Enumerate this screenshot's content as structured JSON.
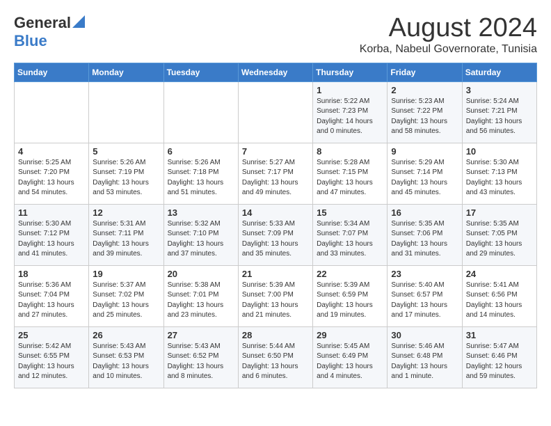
{
  "header": {
    "logo_general": "General",
    "logo_blue": "Blue",
    "month_title": "August 2024",
    "location": "Korba, Nabeul Governorate, Tunisia"
  },
  "days_of_week": [
    "Sunday",
    "Monday",
    "Tuesday",
    "Wednesday",
    "Thursday",
    "Friday",
    "Saturday"
  ],
  "weeks": [
    [
      {
        "day": "",
        "content": ""
      },
      {
        "day": "",
        "content": ""
      },
      {
        "day": "",
        "content": ""
      },
      {
        "day": "",
        "content": ""
      },
      {
        "day": "1",
        "content": "Sunrise: 5:22 AM\nSunset: 7:23 PM\nDaylight: 14 hours\nand 0 minutes."
      },
      {
        "day": "2",
        "content": "Sunrise: 5:23 AM\nSunset: 7:22 PM\nDaylight: 13 hours\nand 58 minutes."
      },
      {
        "day": "3",
        "content": "Sunrise: 5:24 AM\nSunset: 7:21 PM\nDaylight: 13 hours\nand 56 minutes."
      }
    ],
    [
      {
        "day": "4",
        "content": "Sunrise: 5:25 AM\nSunset: 7:20 PM\nDaylight: 13 hours\nand 54 minutes."
      },
      {
        "day": "5",
        "content": "Sunrise: 5:26 AM\nSunset: 7:19 PM\nDaylight: 13 hours\nand 53 minutes."
      },
      {
        "day": "6",
        "content": "Sunrise: 5:26 AM\nSunset: 7:18 PM\nDaylight: 13 hours\nand 51 minutes."
      },
      {
        "day": "7",
        "content": "Sunrise: 5:27 AM\nSunset: 7:17 PM\nDaylight: 13 hours\nand 49 minutes."
      },
      {
        "day": "8",
        "content": "Sunrise: 5:28 AM\nSunset: 7:15 PM\nDaylight: 13 hours\nand 47 minutes."
      },
      {
        "day": "9",
        "content": "Sunrise: 5:29 AM\nSunset: 7:14 PM\nDaylight: 13 hours\nand 45 minutes."
      },
      {
        "day": "10",
        "content": "Sunrise: 5:30 AM\nSunset: 7:13 PM\nDaylight: 13 hours\nand 43 minutes."
      }
    ],
    [
      {
        "day": "11",
        "content": "Sunrise: 5:30 AM\nSunset: 7:12 PM\nDaylight: 13 hours\nand 41 minutes."
      },
      {
        "day": "12",
        "content": "Sunrise: 5:31 AM\nSunset: 7:11 PM\nDaylight: 13 hours\nand 39 minutes."
      },
      {
        "day": "13",
        "content": "Sunrise: 5:32 AM\nSunset: 7:10 PM\nDaylight: 13 hours\nand 37 minutes."
      },
      {
        "day": "14",
        "content": "Sunrise: 5:33 AM\nSunset: 7:09 PM\nDaylight: 13 hours\nand 35 minutes."
      },
      {
        "day": "15",
        "content": "Sunrise: 5:34 AM\nSunset: 7:07 PM\nDaylight: 13 hours\nand 33 minutes."
      },
      {
        "day": "16",
        "content": "Sunrise: 5:35 AM\nSunset: 7:06 PM\nDaylight: 13 hours\nand 31 minutes."
      },
      {
        "day": "17",
        "content": "Sunrise: 5:35 AM\nSunset: 7:05 PM\nDaylight: 13 hours\nand 29 minutes."
      }
    ],
    [
      {
        "day": "18",
        "content": "Sunrise: 5:36 AM\nSunset: 7:04 PM\nDaylight: 13 hours\nand 27 minutes."
      },
      {
        "day": "19",
        "content": "Sunrise: 5:37 AM\nSunset: 7:02 PM\nDaylight: 13 hours\nand 25 minutes."
      },
      {
        "day": "20",
        "content": "Sunrise: 5:38 AM\nSunset: 7:01 PM\nDaylight: 13 hours\nand 23 minutes."
      },
      {
        "day": "21",
        "content": "Sunrise: 5:39 AM\nSunset: 7:00 PM\nDaylight: 13 hours\nand 21 minutes."
      },
      {
        "day": "22",
        "content": "Sunrise: 5:39 AM\nSunset: 6:59 PM\nDaylight: 13 hours\nand 19 minutes."
      },
      {
        "day": "23",
        "content": "Sunrise: 5:40 AM\nSunset: 6:57 PM\nDaylight: 13 hours\nand 17 minutes."
      },
      {
        "day": "24",
        "content": "Sunrise: 5:41 AM\nSunset: 6:56 PM\nDaylight: 13 hours\nand 14 minutes."
      }
    ],
    [
      {
        "day": "25",
        "content": "Sunrise: 5:42 AM\nSunset: 6:55 PM\nDaylight: 13 hours\nand 12 minutes."
      },
      {
        "day": "26",
        "content": "Sunrise: 5:43 AM\nSunset: 6:53 PM\nDaylight: 13 hours\nand 10 minutes."
      },
      {
        "day": "27",
        "content": "Sunrise: 5:43 AM\nSunset: 6:52 PM\nDaylight: 13 hours\nand 8 minutes."
      },
      {
        "day": "28",
        "content": "Sunrise: 5:44 AM\nSunset: 6:50 PM\nDaylight: 13 hours\nand 6 minutes."
      },
      {
        "day": "29",
        "content": "Sunrise: 5:45 AM\nSunset: 6:49 PM\nDaylight: 13 hours\nand 4 minutes."
      },
      {
        "day": "30",
        "content": "Sunrise: 5:46 AM\nSunset: 6:48 PM\nDaylight: 13 hours\nand 1 minute."
      },
      {
        "day": "31",
        "content": "Sunrise: 5:47 AM\nSunset: 6:46 PM\nDaylight: 12 hours\nand 59 minutes."
      }
    ]
  ]
}
